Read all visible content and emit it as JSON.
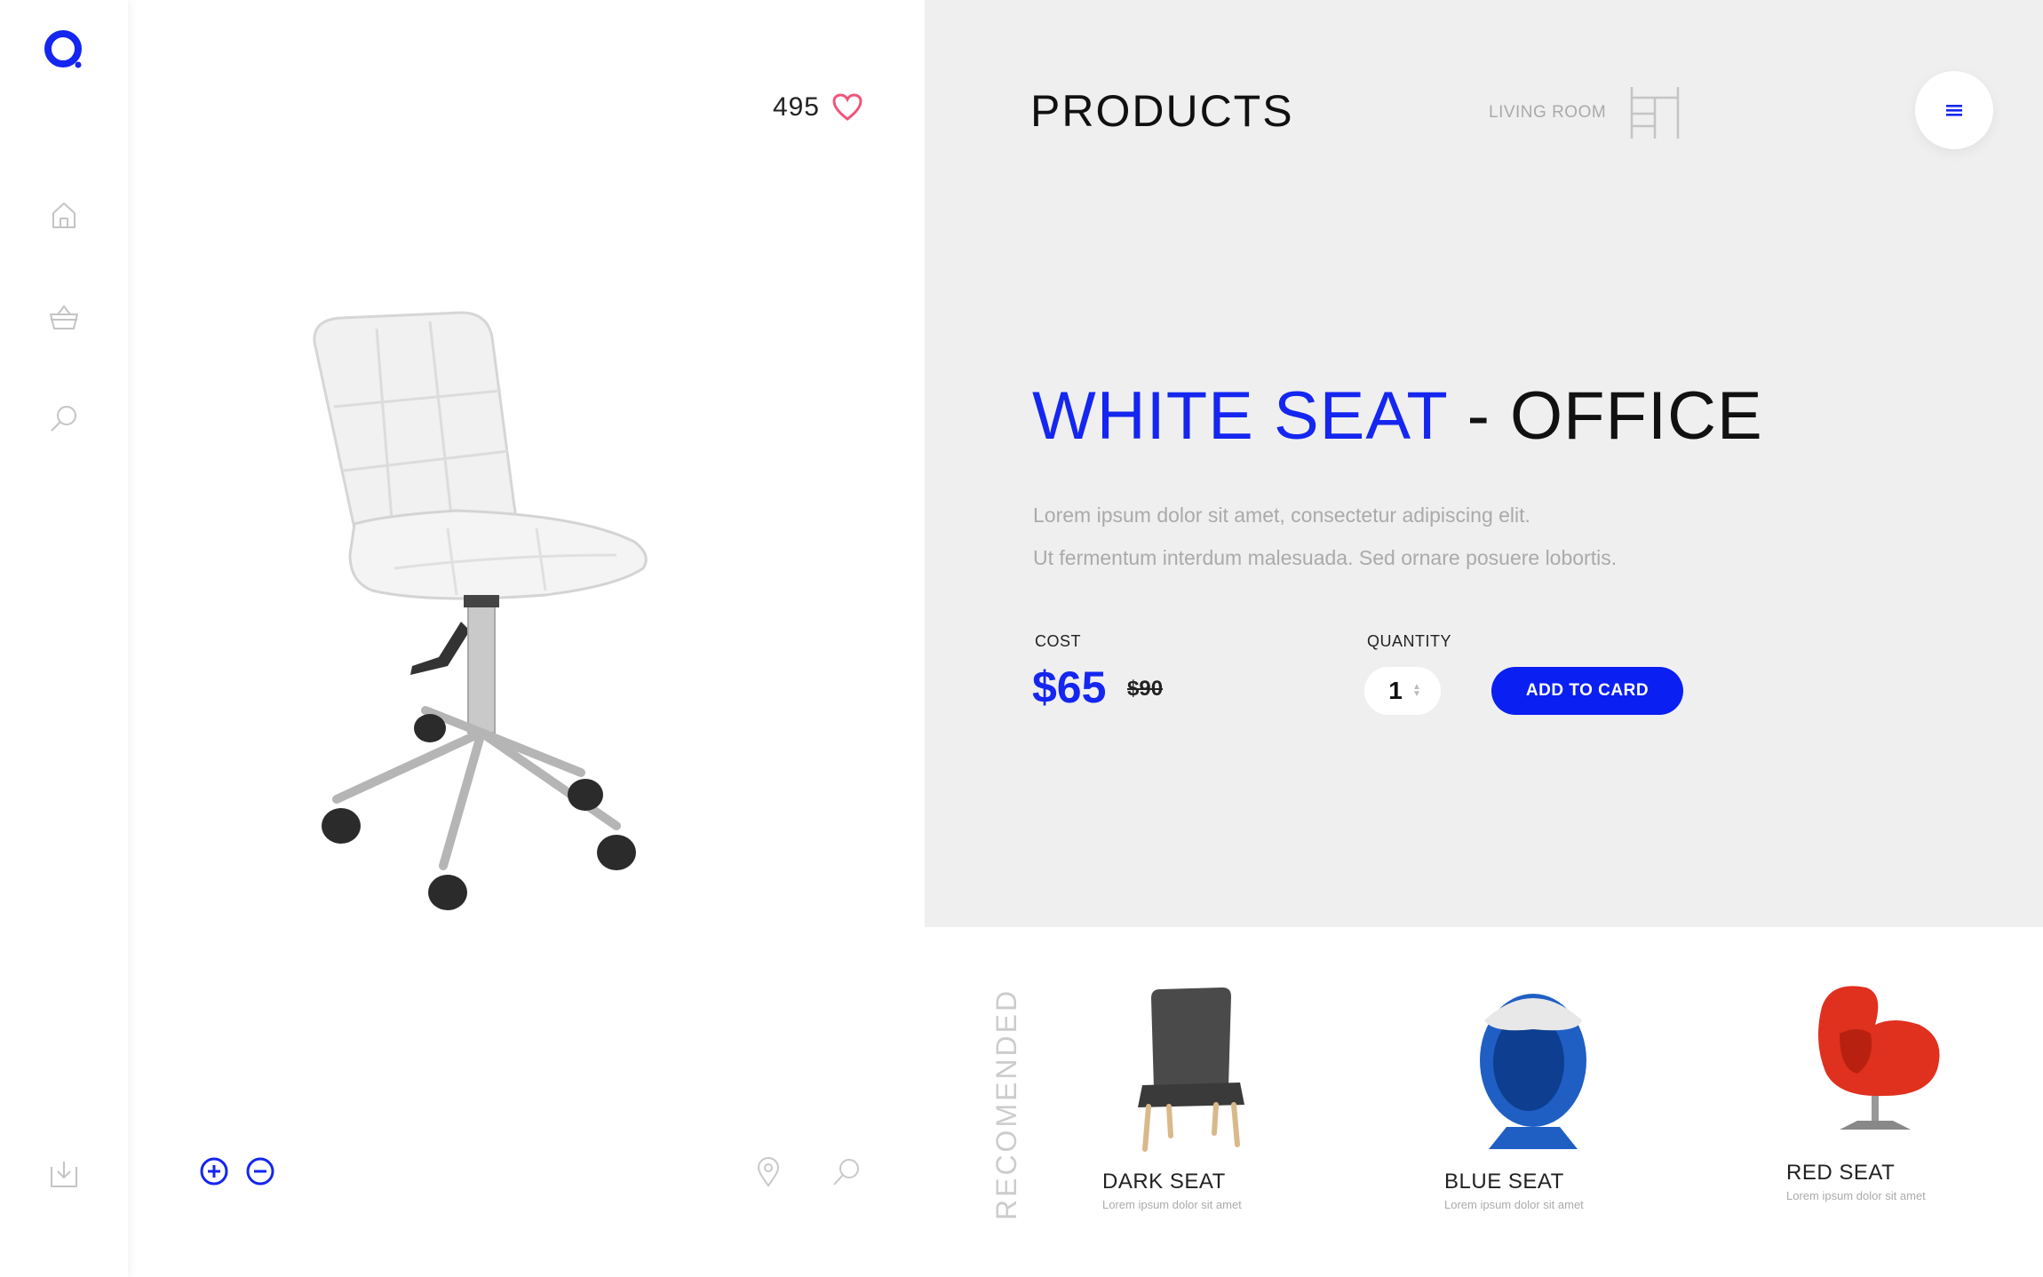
{
  "sidebar": {
    "logo": "brand-logo",
    "nav": [
      {
        "icon": "home-icon"
      },
      {
        "icon": "basket-icon"
      },
      {
        "icon": "search-icon"
      },
      {
        "icon": "download-icon"
      }
    ]
  },
  "viewer": {
    "likes": "495",
    "image": "white-office-chair"
  },
  "header": {
    "title": "PRODUCTS",
    "category": "LIVING ROOM"
  },
  "product": {
    "name": "WHITE SEAT",
    "separator": " - ",
    "type": "OFFICE",
    "description": [
      "Lorem ipsum dolor sit amet, consectetur adipiscing elit.",
      "Ut fermentum interdum malesuada. Sed ornare posuere lobortis."
    ],
    "cost_label": "COST",
    "price": "$65",
    "old_price": "$90",
    "quantity_label": "QUANTITY",
    "quantity": "1",
    "add_button": "ADD TO CARD"
  },
  "recommended": {
    "label": "RECOMENDED",
    "items": [
      {
        "name": "DARK SEAT",
        "desc": "Lorem ipsum dolor sit amet"
      },
      {
        "name": "BLUE SEAT",
        "desc": "Lorem ipsum dolor sit amet"
      },
      {
        "name": "RED SEAT",
        "desc": "Lorem ipsum dolor sit amet"
      }
    ]
  },
  "colors": {
    "accent": "#1426f0",
    "heart": "#f0557a",
    "panel": "#efefef"
  }
}
